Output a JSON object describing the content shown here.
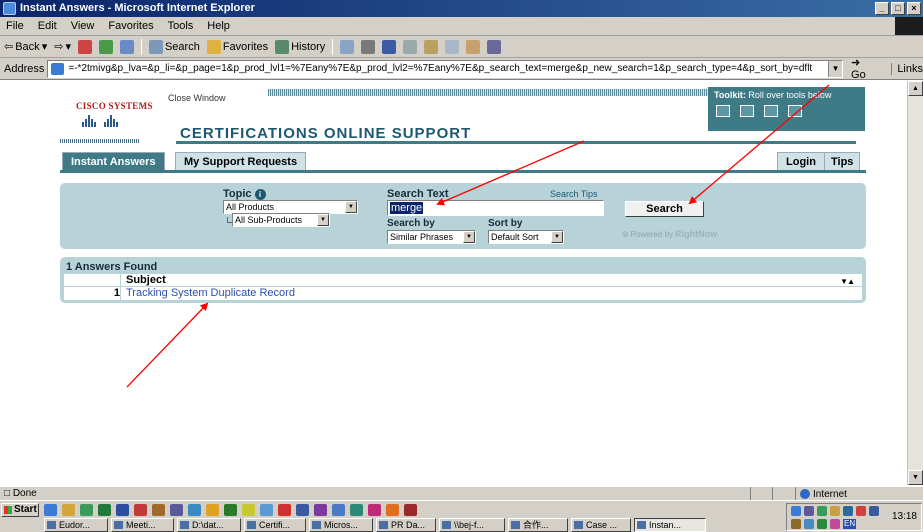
{
  "window": {
    "title": "Instant Answers - Microsoft Internet Explorer",
    "buttons": [
      "_",
      "□",
      "×"
    ]
  },
  "menu": [
    "File",
    "Edit",
    "View",
    "Favorites",
    "Tools",
    "Help"
  ],
  "toolbar": {
    "back": "Back",
    "back_arrow": "⇦",
    "forward_arrow": "⇨",
    "dropdown": "▾",
    "search": "Search",
    "favorites": "Favorites",
    "history": "History",
    "icons": [
      "stop-icon",
      "refresh-icon",
      "home-icon",
      "mail-icon",
      "print-icon",
      "edit-icon",
      "discuss-icon",
      "messenger-icon"
    ]
  },
  "address": {
    "label": "Address",
    "url": "=-*2tmivg&p_lva=&p_li=&p_page=1&p_prod_lvl1=%7Eany%7E&p_prod_lvl2=%7Eany%7E&p_search_text=merge&p_new_search=1&p_search_type=4&p_sort_by=dflt",
    "go": "Go",
    "links": "Links"
  },
  "page": {
    "brand": "Cisco Systems",
    "close_window": "Close Window",
    "heading": "CERTIFICATIONS ONLINE SUPPORT",
    "toolkit_label": "Toolkit:",
    "toolkit_hint": "Roll over tools below",
    "toolkit_icons": [
      "print-icon",
      "email-icon",
      "add-icon",
      "bookmark-icon"
    ],
    "tabs": {
      "instant_answers": "Instant Answers",
      "my_support": "My Support Requests",
      "login": "Login",
      "tips": "Tips"
    },
    "search_form": {
      "topic_label": "Topic",
      "info_glyph": "i",
      "products": "All Products",
      "sub_products": "All Sub-Products",
      "search_text_label": "Search Text",
      "search_tips": "Search Tips",
      "search_value": "merge",
      "search_by_label": "Search by",
      "search_by_value": "Similar Phrases",
      "sort_by_label": "Sort by",
      "sort_by_value": "Default Sort",
      "search_button": "Search",
      "powered_by": "Powered by",
      "powered_brand": "RightNow"
    },
    "results": {
      "count_text": "1 Answers Found",
      "column_subject": "Subject",
      "sort_glyph": "▼▲",
      "rows": [
        {
          "num": "1",
          "subject": "Tracking System Duplicate Record"
        }
      ]
    }
  },
  "annotation_color": "#ff0000",
  "status": {
    "text": "Done",
    "zone": "Internet"
  },
  "taskbar": {
    "start": "Start",
    "tasks": [
      "Eudor...",
      "Meeti...",
      "D:\\dat...",
      "Certifi...",
      "Micros...",
      "PR Da...",
      "\\\\bej-f...",
      "合作...",
      "Case ...",
      "Instan..."
    ],
    "tray_time": "13:18",
    "tray_lang": "EN"
  }
}
